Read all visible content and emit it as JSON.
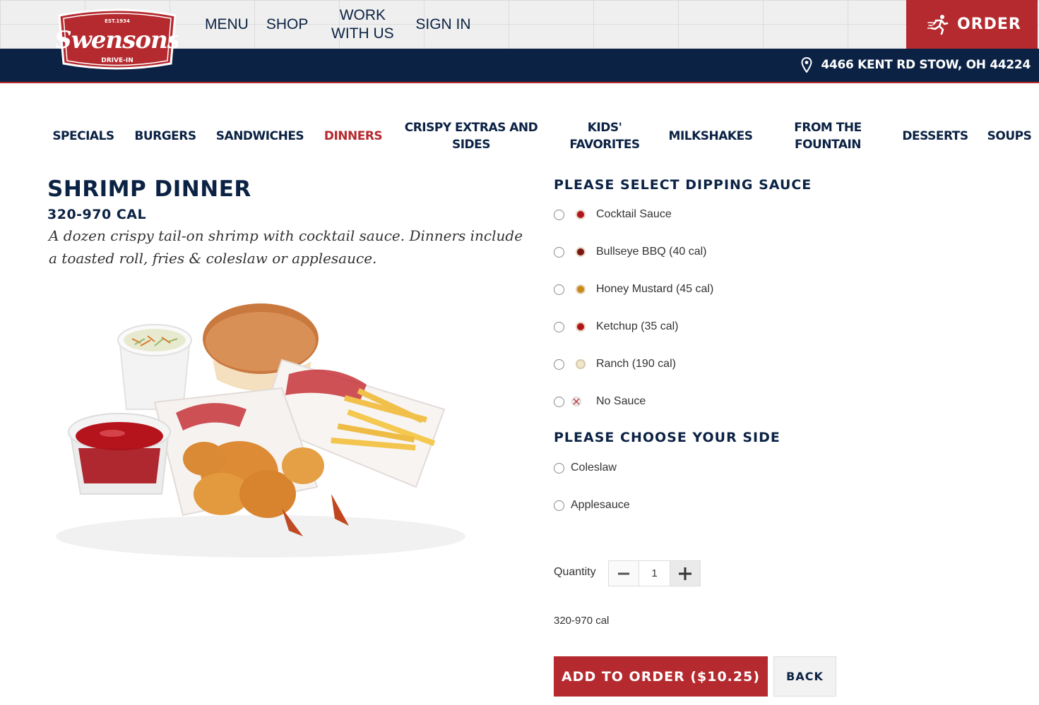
{
  "header": {
    "logo": {
      "brand": "Swensons",
      "established": "EST.1934",
      "tagline": "DRIVE-IN"
    },
    "nav": [
      {
        "label": "MENU"
      },
      {
        "label": "SHOP"
      },
      {
        "label_line1": "WORK",
        "label_line2": "WITH US"
      },
      {
        "label": "SIGN IN"
      }
    ],
    "order_label": "ORDER",
    "order_icon": "running-man-icon",
    "location_icon": "map-pin-icon",
    "location": "4466 KENT RD STOW, OH 44224"
  },
  "categories": [
    {
      "label": "SPECIALS"
    },
    {
      "label": "BURGERS"
    },
    {
      "label": "SANDWICHES"
    },
    {
      "label": "DINNERS",
      "active": true
    },
    {
      "label_line1": "CRISPY EXTRAS AND",
      "label_line2": "SIDES"
    },
    {
      "label_line1": "KIDS'",
      "label_line2": "FAVORITES"
    },
    {
      "label": "MILKSHAKES"
    },
    {
      "label_line1": "FROM THE",
      "label_line2": "FOUNTAIN"
    },
    {
      "label": "DESSERTS"
    },
    {
      "label": "SOUPS"
    }
  ],
  "product": {
    "title": "SHRIMP DINNER",
    "calories": "320-970 CAL",
    "description": "A dozen crispy tail-on shrimp with cocktail sauce. Dinners include a toasted roll, fries & coleslaw or applesauce.",
    "image_alt": "Shrimp dinner with coleslaw, toasted roll, fries and cocktail sauce"
  },
  "sauce": {
    "heading": "PLEASE SELECT DIPPING SAUCE",
    "options": [
      {
        "label": "Cocktail Sauce",
        "color": "#b0141e"
      },
      {
        "label": "Bullseye BBQ  (40 cal)",
        "color": "#7a1512"
      },
      {
        "label": "Honey Mustard  (45 cal)",
        "color": "#c98a17"
      },
      {
        "label": "Ketchup  (35 cal)",
        "color": "#b3131b"
      },
      {
        "label": "Ranch  (190 cal)",
        "color": "#efe6cf"
      },
      {
        "label": "No Sauce",
        "color": "#f4eeee"
      }
    ]
  },
  "side": {
    "heading": "PLEASE CHOOSE YOUR SIDE",
    "options": [
      {
        "label": "Coleslaw"
      },
      {
        "label": "Applesauce"
      }
    ]
  },
  "quantity": {
    "label": "Quantity",
    "value": "1"
  },
  "calories_summary": "320-970 cal",
  "actions": {
    "add_label": "ADD TO ORDER ($10.25)",
    "back_label": "BACK"
  },
  "colors": {
    "navy": "#0b2244",
    "red": "#b52a2f"
  }
}
